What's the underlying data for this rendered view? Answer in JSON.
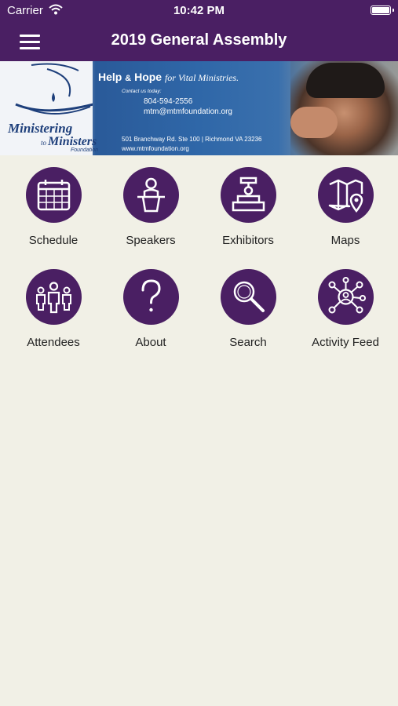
{
  "status_bar": {
    "carrier": "Carrier",
    "time": "10:42 PM"
  },
  "nav": {
    "title": "2019 General Assembly",
    "menu_icon": "hamburger-menu-icon"
  },
  "banner": {
    "logo_line1": "Ministering",
    "logo_to": "to",
    "logo_line2": "Ministers",
    "logo_sub": "Foundation",
    "headline_help": "Help",
    "headline_amp": "&",
    "headline_hope": "Hope",
    "headline_rest": "for Vital Ministries.",
    "contact_label": "Contact us today:",
    "phone": "804-594-2556",
    "email": "mtm@mtmfoundation.org",
    "address": "501 Branchway Rd. Ste 100  |  Richmond VA 23236",
    "website": "www.mtmfoundation.org"
  },
  "tiles": [
    {
      "label": "Schedule",
      "icon": "calendar-icon"
    },
    {
      "label": "Speakers",
      "icon": "podium-speaker-icon"
    },
    {
      "label": "Exhibitors",
      "icon": "exhibitor-booth-icon"
    },
    {
      "label": "Maps",
      "icon": "map-pin-icon"
    },
    {
      "label": "Attendees",
      "icon": "people-group-icon"
    },
    {
      "label": "About",
      "icon": "question-mark-icon"
    },
    {
      "label": "Search",
      "icon": "magnifier-icon"
    },
    {
      "label": "Activity Feed",
      "icon": "network-feed-icon"
    }
  ],
  "colors": {
    "brand": "#4a1f63",
    "background": "#f1f0e6"
  }
}
